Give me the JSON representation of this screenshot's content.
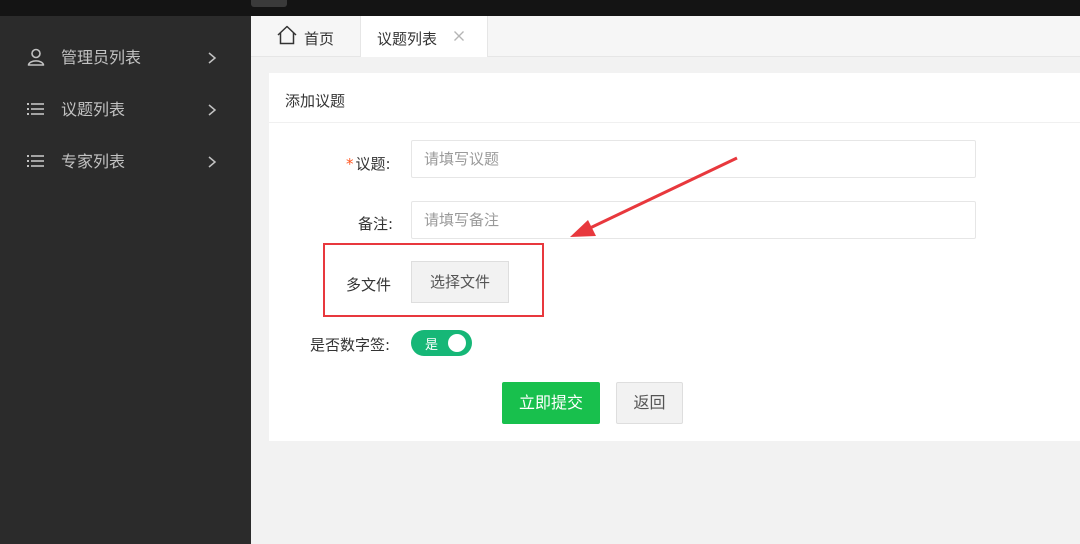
{
  "sidebar": {
    "items": [
      {
        "label": "管理员列表",
        "icon": "user-icon"
      },
      {
        "label": "议题列表",
        "icon": "list-icon"
      },
      {
        "label": "专家列表",
        "icon": "list-icon"
      }
    ]
  },
  "tabs": {
    "home_label": "首页",
    "active_label": "议题列表"
  },
  "card": {
    "title": "添加议题"
  },
  "form": {
    "topic_label": "议题:",
    "topic_required_mark": "*",
    "topic_placeholder": "请填写议题",
    "note_label": "备注:",
    "note_placeholder": "请填写备注",
    "files_label": "多文件",
    "choose_file_label": "选择文件",
    "signature_label": "是否数字签:",
    "signature_value": "是",
    "submit_label": "立即提交",
    "back_label": "返回"
  },
  "colors": {
    "sidebar_bg": "#2b2b2b",
    "primary_green": "#18c04d",
    "switch_on": "#16b777",
    "annotation_red": "#e8383d"
  }
}
